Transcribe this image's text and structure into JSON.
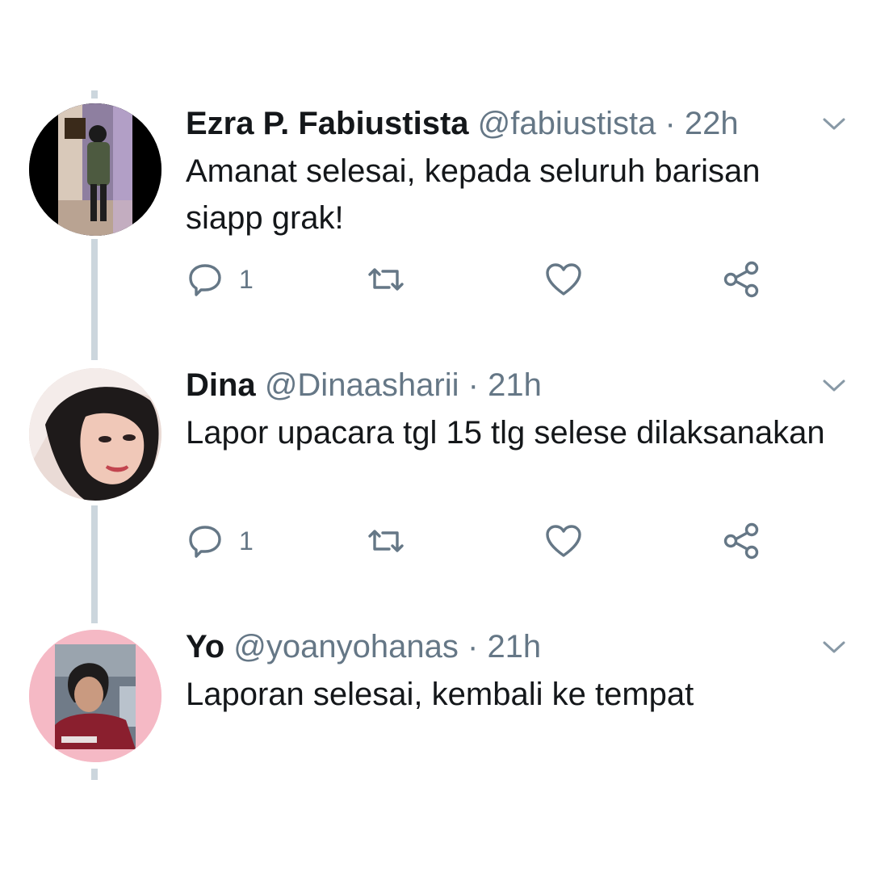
{
  "colors": {
    "thread_line": "#ccd6dd",
    "secondary_text": "#657786",
    "primary_text": "#14171a",
    "icon_stroke": "#657786"
  },
  "tweets": [
    {
      "display_name": "Ezra P. Fabiustista",
      "handle": "@fabiustista",
      "separator": "·",
      "time": "22h",
      "text": "Amanat selesai, kepada seluruh barisan siapp grak!",
      "reply_count": "1",
      "avatar": "profile-photo",
      "icons": [
        "reply-icon",
        "retweet-icon",
        "like-icon",
        "share-icon",
        "chevron-down-icon"
      ]
    },
    {
      "display_name": "Dina",
      "handle": "@Dinaasharii",
      "separator": "·",
      "time": "21h",
      "text": "Lapor upacara tgl 15 tlg selese dilaksanakan",
      "reply_count": "1",
      "avatar": "profile-photo",
      "icons": [
        "reply-icon",
        "retweet-icon",
        "like-icon",
        "share-icon",
        "chevron-down-icon"
      ]
    },
    {
      "display_name": "Yo",
      "handle": "@yoanyohanas",
      "separator": "·",
      "time": "21h",
      "text": "Laporan selesai, kembali ke tempat",
      "avatar": "profile-photo",
      "icons": [
        "chevron-down-icon"
      ]
    }
  ]
}
